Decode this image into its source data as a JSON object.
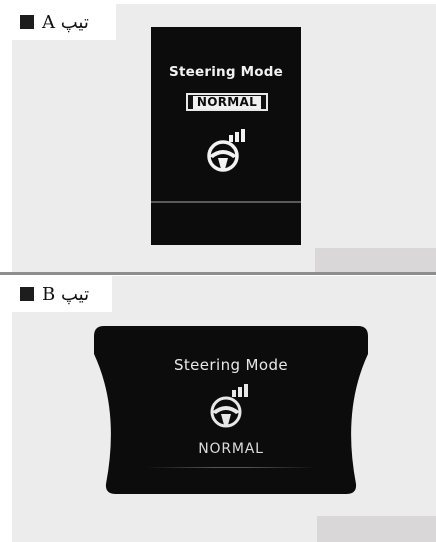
{
  "type_a": {
    "tag_label": "تیپ A",
    "display": {
      "title": "Steering Mode",
      "mode": "NORMAL",
      "icon": "steering-wheel-icon"
    }
  },
  "type_b": {
    "tag_label": "تیپ B",
    "display": {
      "title": "Steering Mode",
      "mode": "NORMAL",
      "icon": "steering-wheel-icon"
    }
  },
  "colors": {
    "background": "#ececec",
    "display": "#0c0c0c",
    "text": "#f2f2f2"
  }
}
